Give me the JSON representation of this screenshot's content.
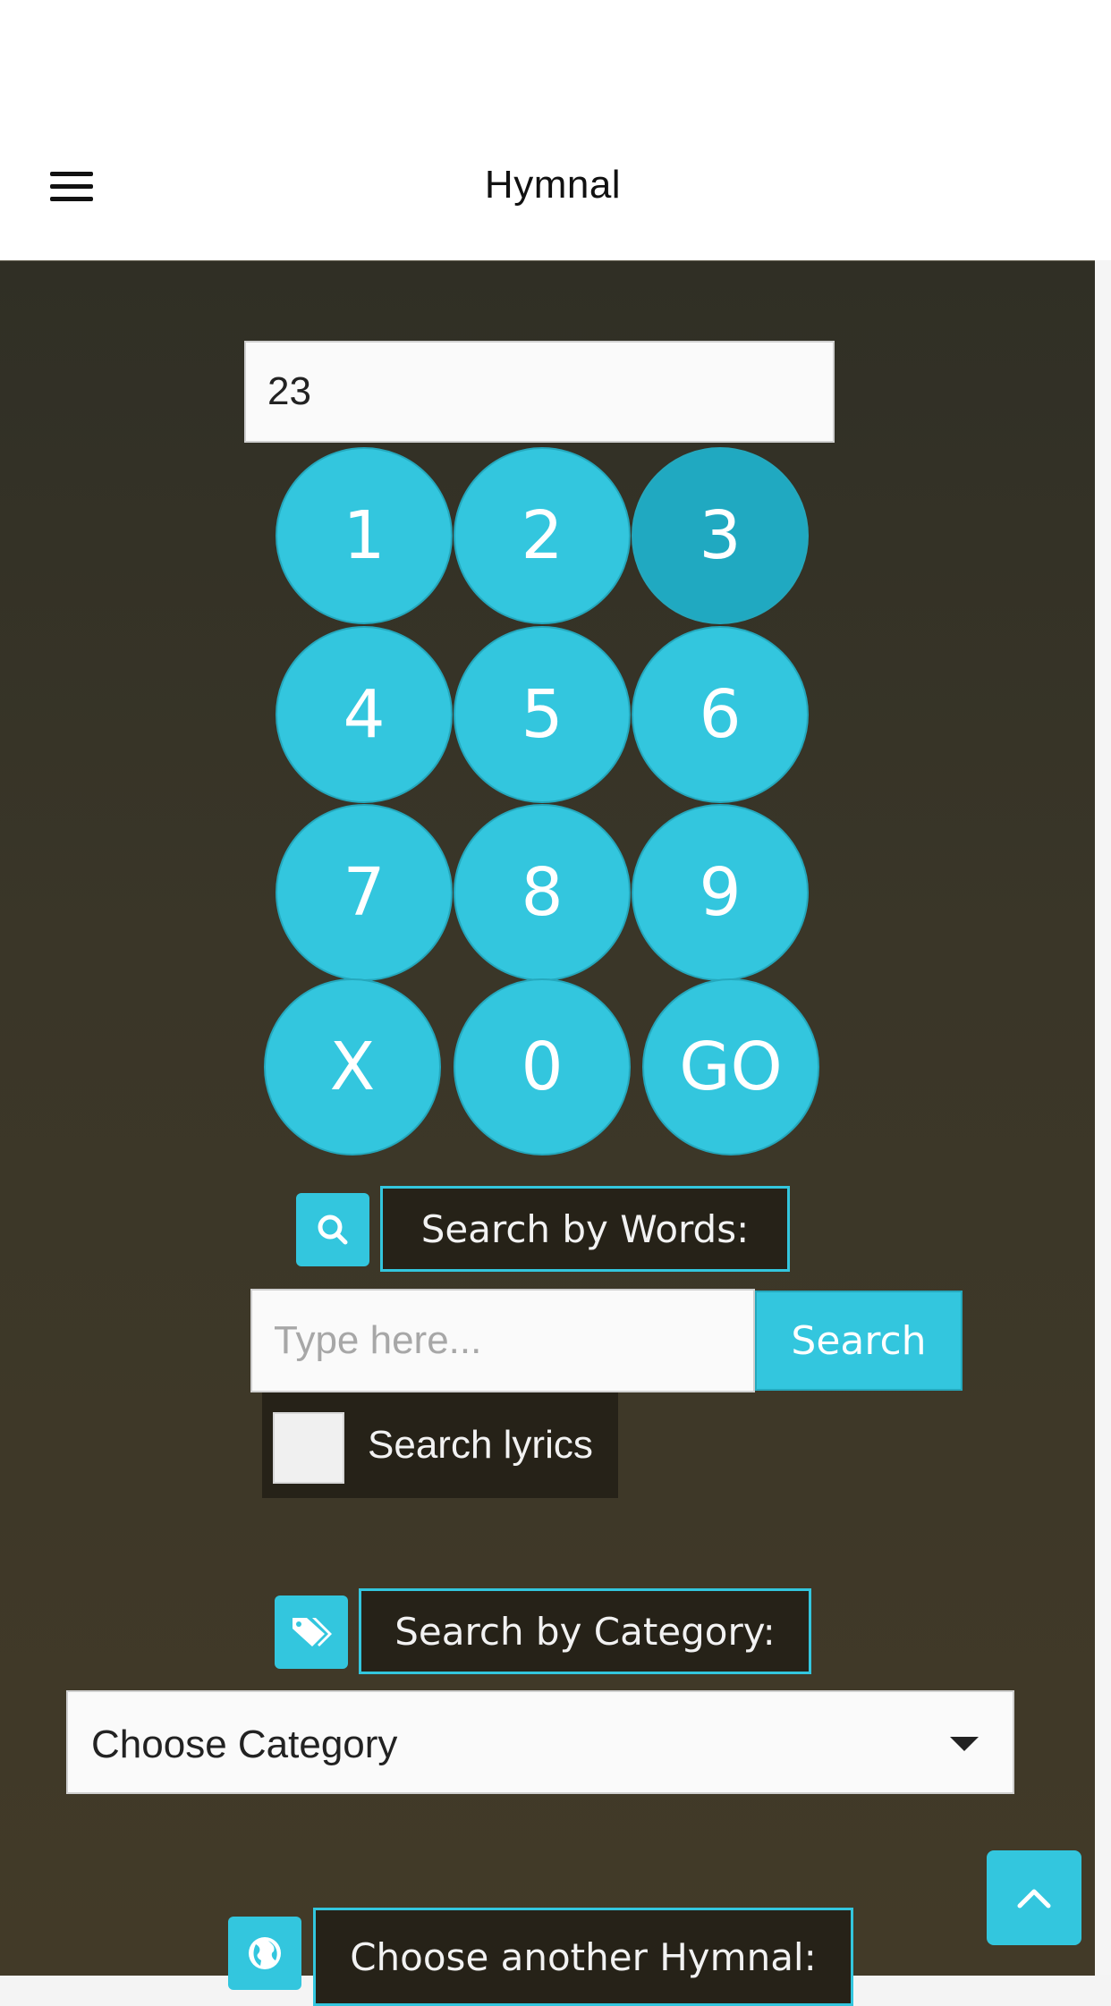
{
  "header": {
    "title": "Hymnal",
    "menu_icon": "hamburger-icon"
  },
  "number_entry": {
    "value": "23"
  },
  "keypad": {
    "keys": [
      "1",
      "2",
      "3",
      "4",
      "5",
      "6",
      "7",
      "8",
      "9",
      "X",
      "0",
      "GO"
    ],
    "active_key": "3"
  },
  "search_words": {
    "icon": "search-icon",
    "heading": "Search by Words:",
    "placeholder": "Type here...",
    "value": "",
    "button_label": "Search",
    "lyrics_label": "Search lyrics",
    "lyrics_checked": false
  },
  "search_category": {
    "icon": "tags-icon",
    "heading": "Search by Category:",
    "selected": "Choose Category"
  },
  "another_hymnal": {
    "icon": "globe-icon",
    "heading": "Choose another Hymnal:"
  },
  "scroll_top": {
    "icon": "chevron-up-icon"
  },
  "colors": {
    "accent": "#33c6de",
    "accent_active": "#20a9c1",
    "background": "#3a3628",
    "label_background": "#262218"
  }
}
